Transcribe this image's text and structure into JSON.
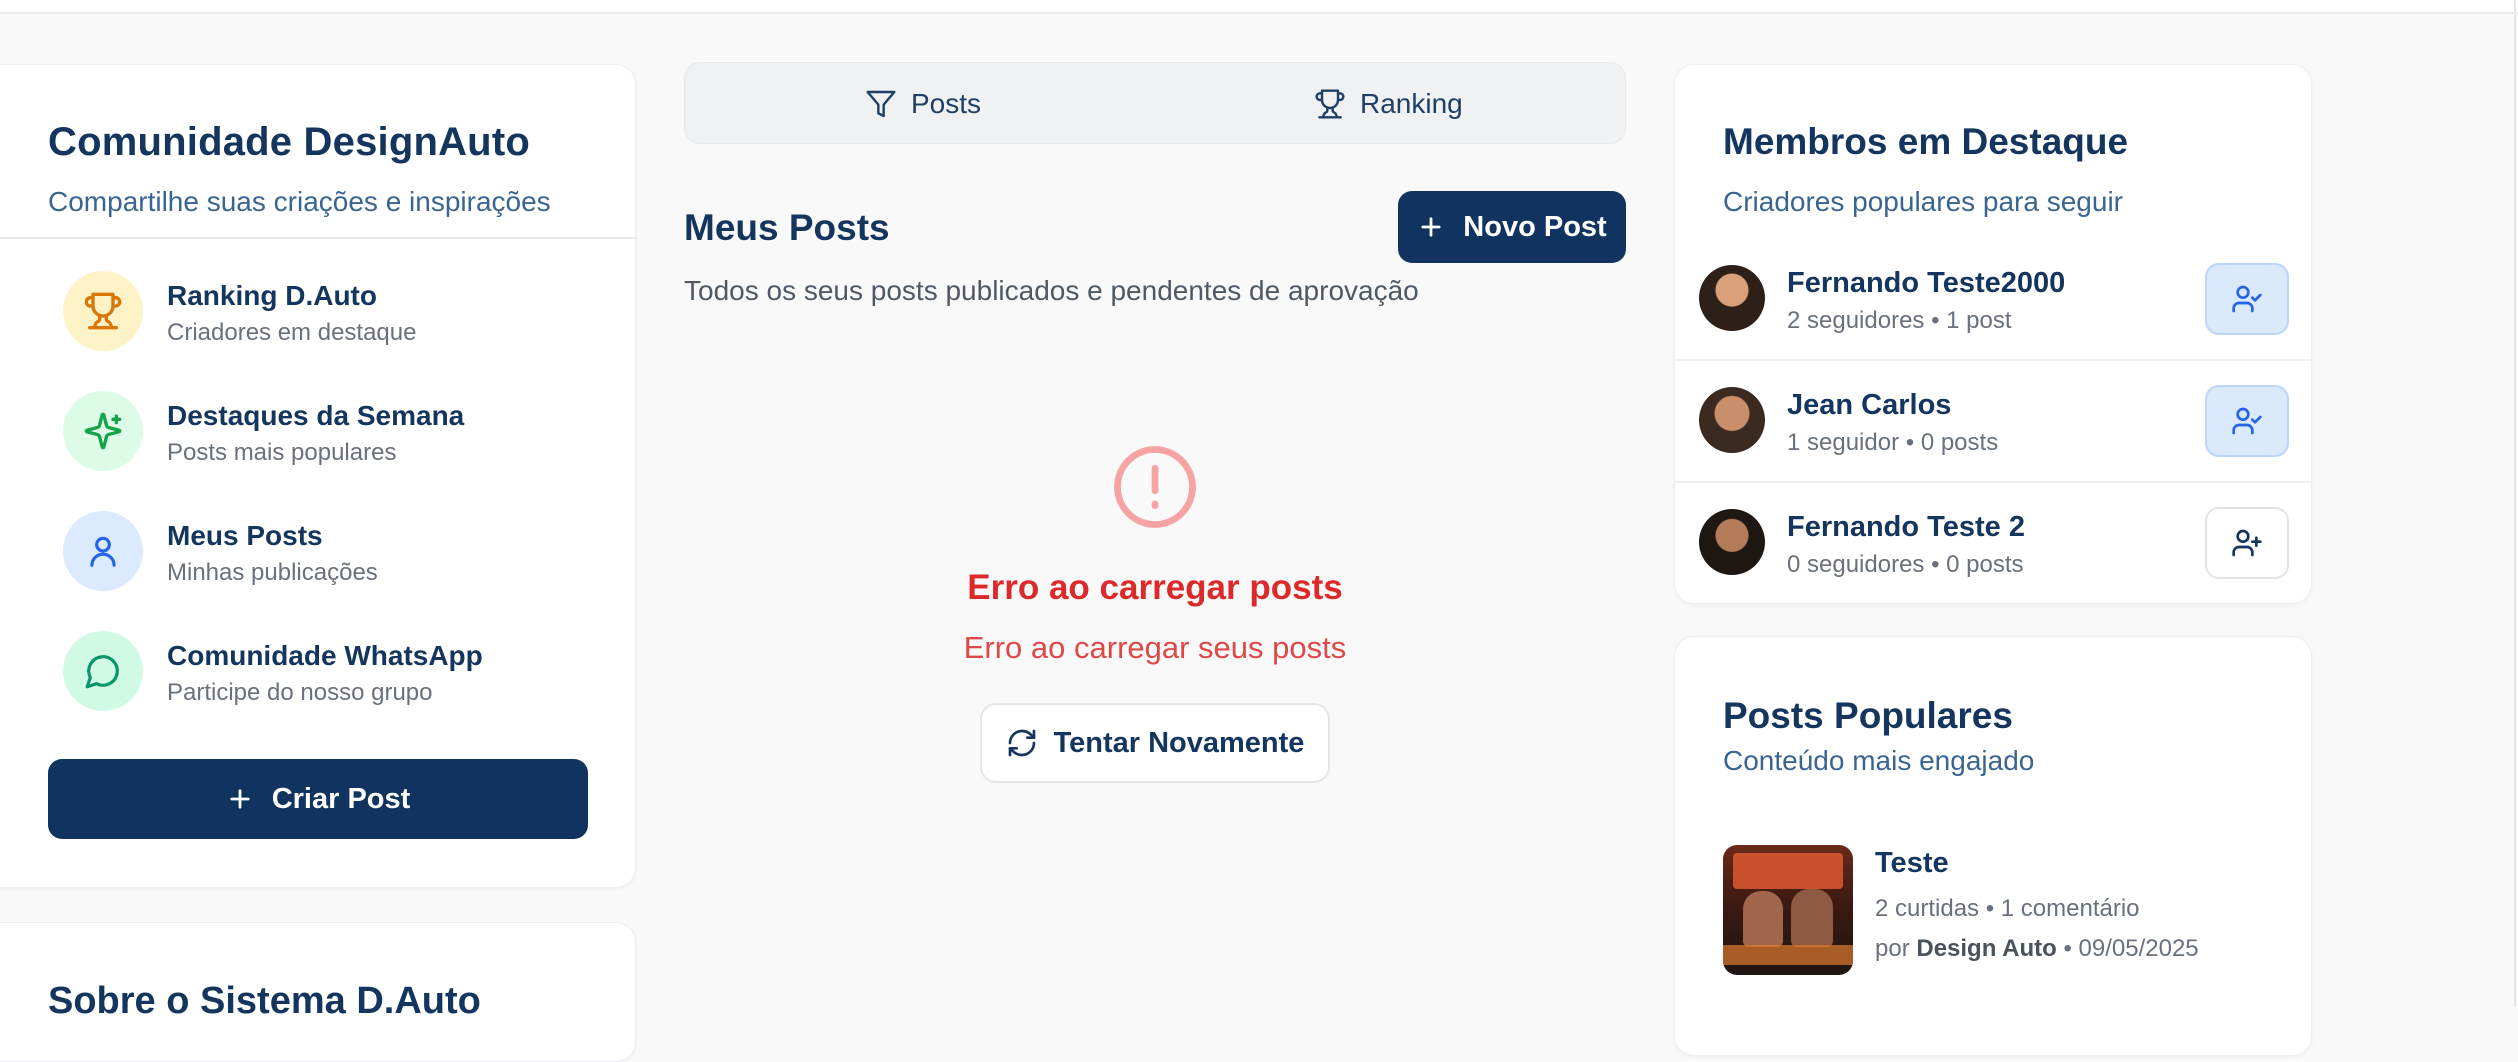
{
  "left_panel": {
    "title": "Comunidade DesignAuto",
    "subtitle": "Compartilhe suas criações e inspirações",
    "menu": [
      {
        "label": "Ranking D.Auto",
        "desc": "Criadores em destaque",
        "icon": "trophy-icon",
        "color": "#d97706",
        "bg": "#fef3c7"
      },
      {
        "label": "Destaques da Semana",
        "desc": "Posts mais populares",
        "icon": "sparkles-icon",
        "color": "#16a34a",
        "bg": "#dcfce7"
      },
      {
        "label": "Meus Posts",
        "desc": "Minhas publicações",
        "icon": "user-icon",
        "color": "#2563eb",
        "bg": "#dbeafe"
      },
      {
        "label": "Comunidade WhatsApp",
        "desc": "Participe do nosso grupo",
        "icon": "message-circle-icon",
        "color": "#059669",
        "bg": "#d1fae5"
      }
    ],
    "create_post_label": "Criar Post",
    "about_title": "Sobre o Sistema D.Auto"
  },
  "tabs": {
    "posts_label": "Posts",
    "ranking_label": "Ranking"
  },
  "main": {
    "title": "Meus Posts",
    "new_post_label": "Novo Post",
    "subtitle": "Todos os seus posts publicados e pendentes de aprovação",
    "error_title": "Erro ao carregar posts",
    "error_message": "Erro ao carregar seus posts",
    "retry_label": "Tentar Novamente"
  },
  "members": {
    "title": "Membros em Destaque",
    "subtitle": "Criadores populares para seguir",
    "list": [
      {
        "name": "Fernando Teste2000",
        "meta": "2 seguidores • 1 post",
        "following": true
      },
      {
        "name": "Jean Carlos",
        "meta": "1 seguidor • 0 posts",
        "following": true
      },
      {
        "name": "Fernando Teste 2",
        "meta": "0 seguidores • 0 posts",
        "following": false
      }
    ]
  },
  "popular": {
    "title": "Posts Populares",
    "subtitle": "Conteúdo mais engajado",
    "post": {
      "title": "Teste",
      "stats": "2 curtidas • 1 comentário",
      "by_prefix": "por",
      "author": "Design Auto",
      "date_suffix": "• 09/05/2025"
    }
  },
  "colors": {
    "primary": "#11335f",
    "error": "#dc2a2a",
    "accent_blue": "#2563eb"
  }
}
